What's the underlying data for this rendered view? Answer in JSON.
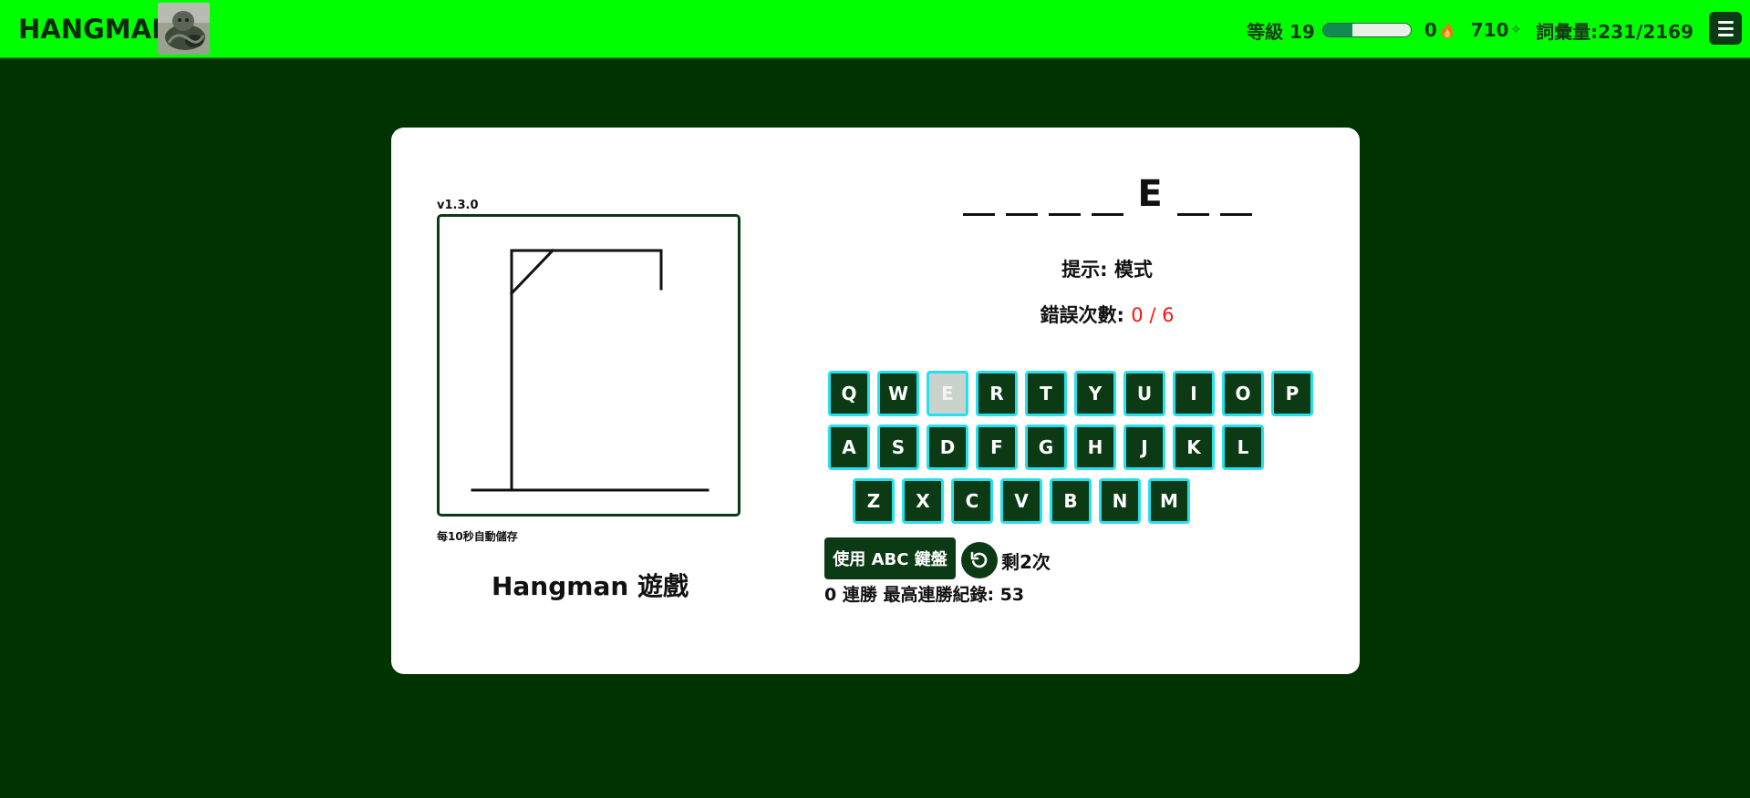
{
  "header": {
    "brand": "HANGMAN",
    "logo": "cat-statue-image",
    "level_label": "等級 19",
    "level_progress": 0.33,
    "streak_count": "0",
    "fire_icon": "fire-icon",
    "points": "710",
    "sparkle_icon": "✧",
    "vocab_label": "詞彙量:231/2169",
    "menu_icon": "hamburger-menu-icon"
  },
  "game": {
    "version": "v1.3.0",
    "autosave_note": "每10秒自動儲存",
    "title": "Hangman 遊戲",
    "word_slots": [
      "",
      "",
      "",
      "",
      "E",
      "",
      ""
    ],
    "hint": "提示: 模式",
    "errors_label": "錯誤次數:",
    "errors_value": "0 / 6",
    "keyboard_rows": [
      [
        "Q",
        "W",
        "E",
        "R",
        "T",
        "Y",
        "U",
        "I",
        "O",
        "P"
      ],
      [
        "A",
        "S",
        "D",
        "F",
        "G",
        "H",
        "J",
        "K",
        "L"
      ],
      [
        "Z",
        "X",
        "C",
        "V",
        "B",
        "N",
        "M"
      ]
    ],
    "used_letters": [
      "E"
    ],
    "abc_button": "使用 ABC 鍵盤",
    "reset_icon": "reset-icon",
    "remaining": "剩2次",
    "streak_line": "0 連勝 最高連勝紀錄: 53"
  },
  "colors": {
    "topbar": "#00ff00",
    "background": "#003300",
    "key_bg": "#0b3a14",
    "key_border": "#27e0ee",
    "error": "#ff1111"
  }
}
